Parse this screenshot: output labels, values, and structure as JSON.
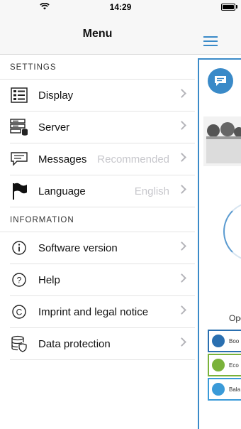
{
  "status_bar": {
    "time": "14:29"
  },
  "menu": {
    "title": "Menu",
    "sections": [
      {
        "title": "SETTINGS",
        "items": [
          {
            "label": "Display",
            "value": "",
            "icon": "display-icon"
          },
          {
            "label": "Server",
            "value": "",
            "icon": "server-icon"
          },
          {
            "label": "Messages",
            "value": "Recommended",
            "icon": "messages-icon"
          },
          {
            "label": "Language",
            "value": "English",
            "icon": "flag-icon"
          }
        ]
      },
      {
        "title": "INFORMATION",
        "items": [
          {
            "label": "Software version",
            "value": "",
            "icon": "info-icon"
          },
          {
            "label": "Help",
            "value": "",
            "icon": "help-icon"
          },
          {
            "label": "Imprint and legal notice",
            "value": "",
            "icon": "copyright-icon"
          },
          {
            "label": "Data protection",
            "value": "",
            "icon": "data-protection-icon"
          }
        ]
      }
    ]
  },
  "background_app": {
    "operation_label": "Ope",
    "modes": [
      "Boo",
      "Eco",
      "Bala"
    ],
    "accent_color": "#3a8ac8"
  }
}
